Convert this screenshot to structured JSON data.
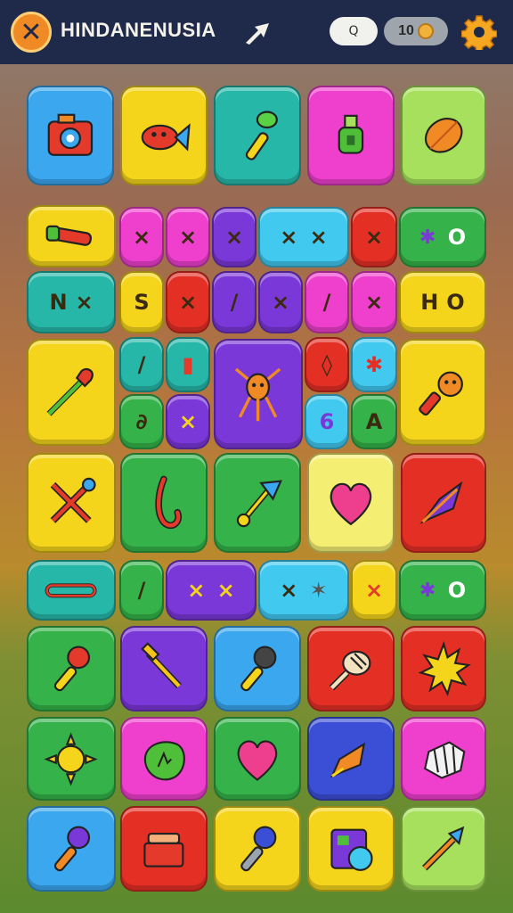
{
  "header": {
    "title": "HINDANENUSIA",
    "close_icon": "close-icon",
    "search_label": "Q",
    "coins": "10"
  },
  "colors": {
    "topbar": "#1f2a4b",
    "blue": "#3aa7ee",
    "yellow": "#f5d51b",
    "green": "#35b24a",
    "teal": "#27b7a8",
    "pink": "#ee3fcd",
    "lime": "#a6e05c",
    "red": "#e42f25",
    "purple": "#7b38d8",
    "cyan": "#41c9ef",
    "navy": "#3b4fd6"
  },
  "board": {
    "row1": [
      "camera",
      "red-fish",
      "green-brush",
      "potion-bottle",
      "orange-leaf"
    ],
    "row2_marks": [
      "×",
      "×",
      "×",
      "×",
      "×",
      "×",
      "O"
    ],
    "row3_marks": [
      "N",
      "×",
      "S",
      "×",
      "/",
      "×",
      "/",
      "×",
      "H",
      "O"
    ],
    "row4_marks": [
      "/",
      "▮",
      "∂",
      "×",
      "◊",
      "6",
      "A"
    ],
    "row5": [
      "crossed-tools",
      "red-hook",
      "arrow-dart",
      "pink-heart",
      "purple-shuttle"
    ],
    "row6_marks": [
      "/",
      "×",
      "×",
      "×",
      "✶",
      "×",
      "O"
    ],
    "row7": [
      "red-microphone",
      "golden-pin",
      "blue-microphone",
      "tennis-racket",
      "sun"
    ],
    "row8": [
      "sun",
      "green-badge",
      "heart",
      "pencil",
      "gift-package"
    ],
    "row9": [
      "purple-microphone",
      "red-chest",
      "blue-microphone",
      "game-console",
      "paint-brush"
    ]
  }
}
